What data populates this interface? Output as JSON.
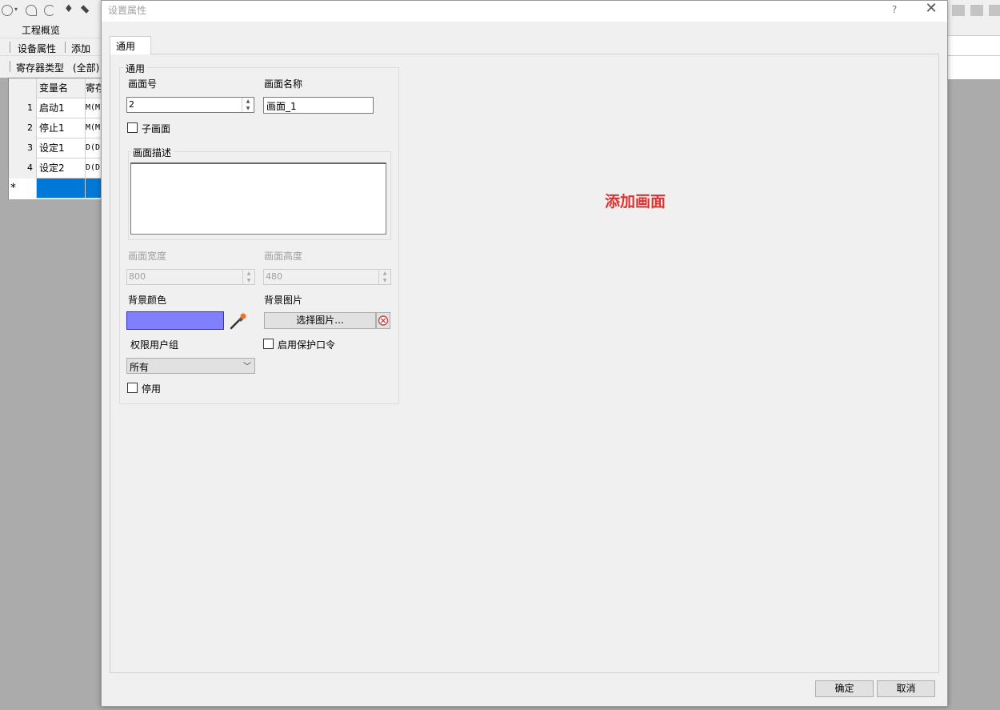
{
  "background_app": {
    "overview_label": "工程概览",
    "nav": {
      "device_props": "设备属性",
      "add": "添加"
    },
    "filter": {
      "reg_type_label": "寄存器类型",
      "reg_type_value": "(全部)"
    },
    "grid": {
      "headers": [
        "变量名",
        "寄存"
      ],
      "rows": [
        {
          "num": "1",
          "name": "启动1",
          "reg": "M(M"
        },
        {
          "num": "2",
          "name": "停止1",
          "reg": "M(M"
        },
        {
          "num": "3",
          "name": "设定1",
          "reg": "D(D"
        },
        {
          "num": "4",
          "name": "设定2",
          "reg": "D(D"
        }
      ],
      "new_row_marker": "*"
    }
  },
  "dialog": {
    "title": "设置属性",
    "help": "?",
    "close": "✕",
    "tab": "通用",
    "group_general": "通用",
    "screen_no_label": "画面号",
    "screen_no_value": "2",
    "screen_name_label": "画面名称",
    "screen_name_value": "画面_1",
    "sub_screen_label": "子画面",
    "desc_group": "画面描述",
    "width_label": "画面宽度",
    "width_value": "800",
    "height_label": "画面高度",
    "height_value": "480",
    "bg_color_label": "背景颜色",
    "bg_color": "#8080ff",
    "bg_image_label": "背景图片",
    "pick_image_button": "选择图片...",
    "perm_group_label": "权限用户组",
    "perm_group_value": "所有",
    "enable_password_label": "启用保护口令",
    "disable_label": "停用",
    "annotation": "添加画面",
    "ok_button": "确定",
    "cancel_button": "取消"
  }
}
